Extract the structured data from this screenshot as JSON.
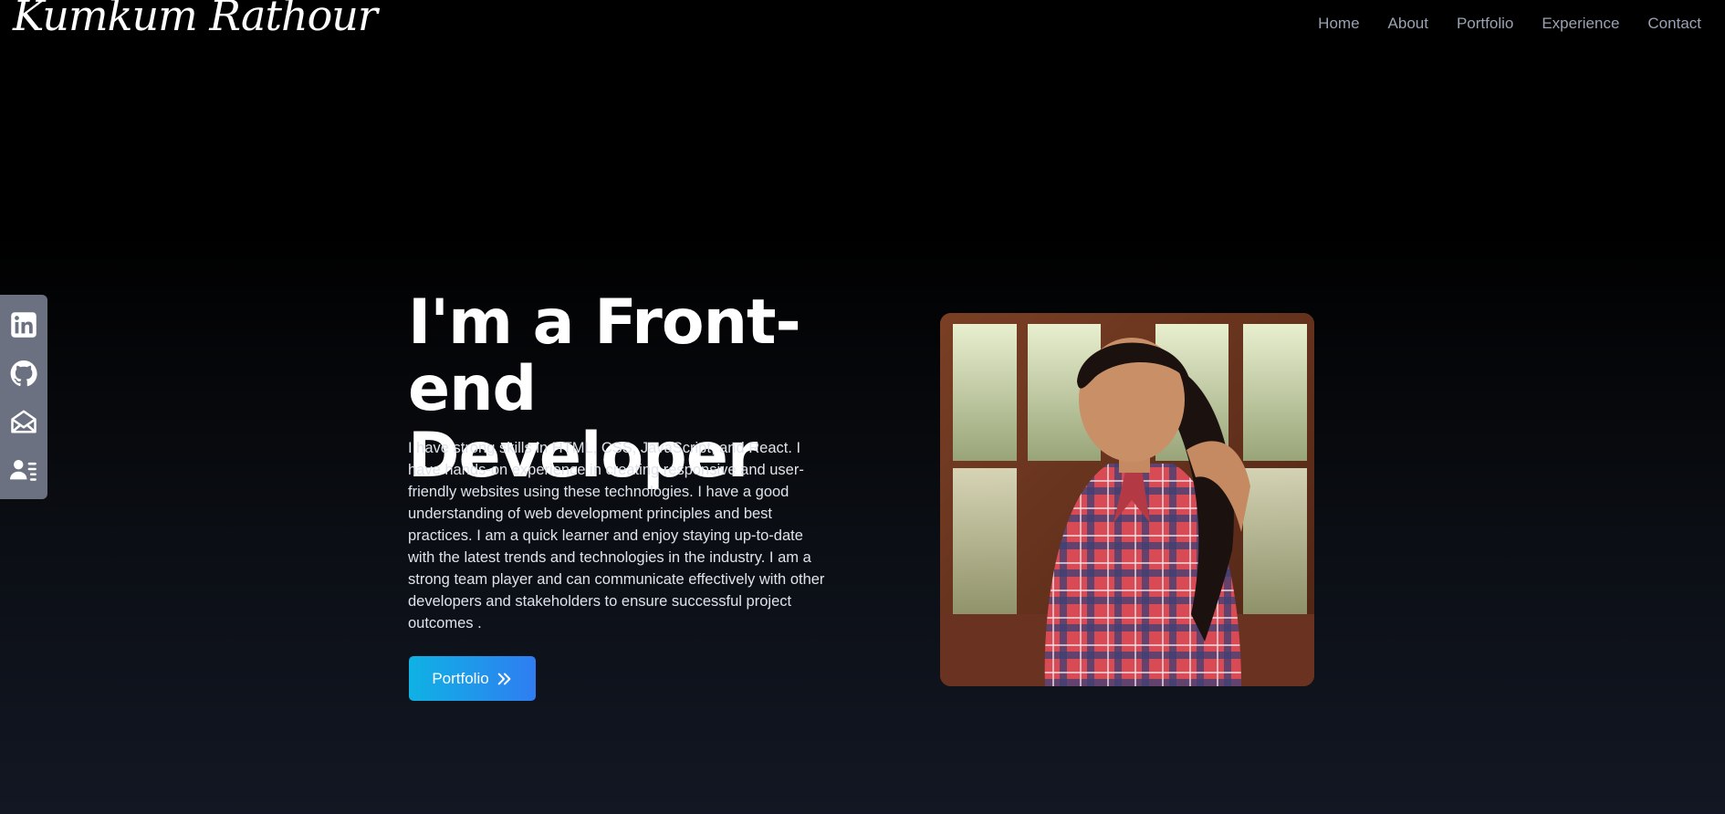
{
  "brand": {
    "name": "Kumkum Rathour"
  },
  "nav": {
    "items": [
      {
        "label": "Home"
      },
      {
        "label": "About"
      },
      {
        "label": "Portfolio"
      },
      {
        "label": "Experience"
      },
      {
        "label": "Contact"
      }
    ],
    "color": "#9aa2b3"
  },
  "social": {
    "icons": [
      "linkedin-icon",
      "github-icon",
      "mail-icon",
      "resume-icon"
    ],
    "background": "#6b7180"
  },
  "hero": {
    "title_line1": "I'm a Front-end",
    "title_line2": "Developer",
    "description": "I have strong skills in HTML, CSS, JavaScript, and React. I have hands-on experience in creating responsive and user-friendly websites using these technologies. I have a good understanding of web development principles and best practices. I am a quick learner and enjoy staying up-to-date with the latest trends and technologies in the industry. I am a strong team player and can communicate effectively with other developers and stakeholders to ensure successful project outcomes .",
    "button_label": "Portfolio",
    "button_icon": "double-chevron-right-icon",
    "button_gradient": [
      "#0fb2e4",
      "#2f7df1"
    ]
  },
  "colors": {
    "background_top": "#000000",
    "background_bottom": "#121723",
    "text": "#ffffff"
  }
}
